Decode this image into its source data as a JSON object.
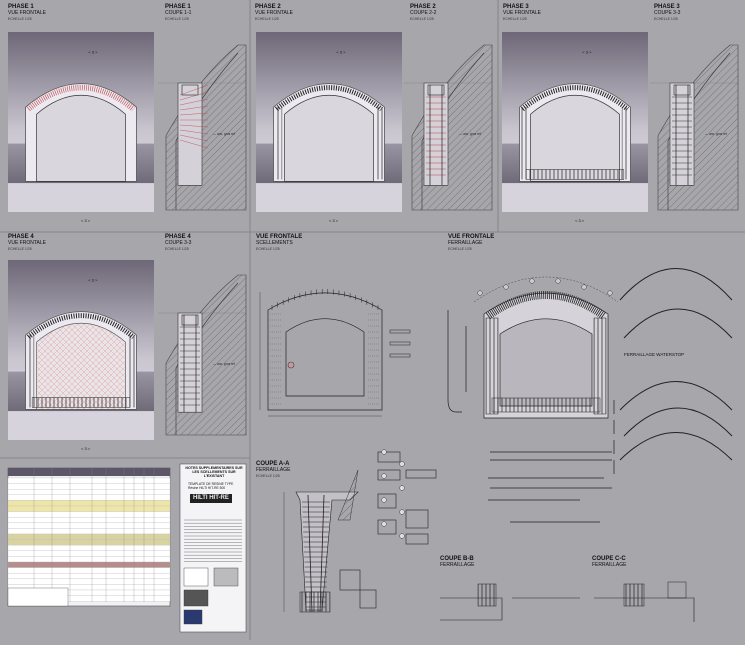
{
  "sheet_title_marks": {
    "phase1": {
      "title": "PHASE 1",
      "view": "VUE FRONTALE",
      "scale": "ECHELLE 1/25"
    },
    "phase1_cut": {
      "title": "PHASE 1",
      "view": "COUPE 1-1",
      "scale": "ECHELLE 1/25"
    },
    "phase2": {
      "title": "PHASE 2",
      "view": "VUE FRONTALE",
      "scale": "ECHELLE 1/25"
    },
    "phase2_cut": {
      "title": "PHASE 2",
      "view": "COUPE 2-2",
      "scale": "ECHELLE 1/25"
    },
    "phase3": {
      "title": "PHASE 3",
      "view": "VUE FRONTALE",
      "scale": "ECHELLE 1/25"
    },
    "phase3_cut": {
      "title": "PHASE 3",
      "view": "COUPE 3-3",
      "scale": "ECHELLE 1/25"
    },
    "phase4": {
      "title": "PHASE 4",
      "view": "VUE FRONTALE",
      "scale": "ECHELLE 1/25"
    },
    "phase4_cut": {
      "title": "PHASE 4",
      "view": "COUPE 3-3",
      "scale": "ECHELLE 1/25"
    },
    "front_scellements": {
      "title": "VUE FRONTALE",
      "view": "SCELLEMENTS",
      "scale": "ECHELLE 1/25"
    },
    "front_ferraillage": {
      "title": "VUE FRONTALE",
      "view": "FERRAILLAGE",
      "scale": "ECHELLE 1/25"
    },
    "waterstop": {
      "title": "FERRAILLAGE WATERSTOP"
    },
    "coupe_aa": {
      "title": "COUPE A-A",
      "view": "FERRAILLAGE",
      "scale": "ECHELLE 1/25"
    },
    "coupe_bb": {
      "title": "COUPE B-B",
      "view": "FERRAILLAGE"
    },
    "coupe_cc": {
      "title": "COUPE C-C",
      "view": "FERRAILLAGE"
    }
  },
  "section_marks": {
    "m1": "1",
    "m2": "2",
    "m3": "3",
    "m4": "3",
    "a": "A",
    "b": "B",
    "c": "C"
  },
  "hilti": {
    "header": "NOTES SUPPLEMENTAIRES SUR LES SCELLEMENTS SUR L'EXISTANT",
    "sub": "TEMPLATE DE RESINE TYPE",
    "product": "Résine HILTI HIT-RE 500",
    "logo": "HILTI HIT-RE"
  },
  "colors": {
    "background": "#a7a6ab",
    "panel_light": "#dcdae2",
    "panel_dark": "#6f6a78",
    "hatch": "#444",
    "red": "#b01818"
  }
}
